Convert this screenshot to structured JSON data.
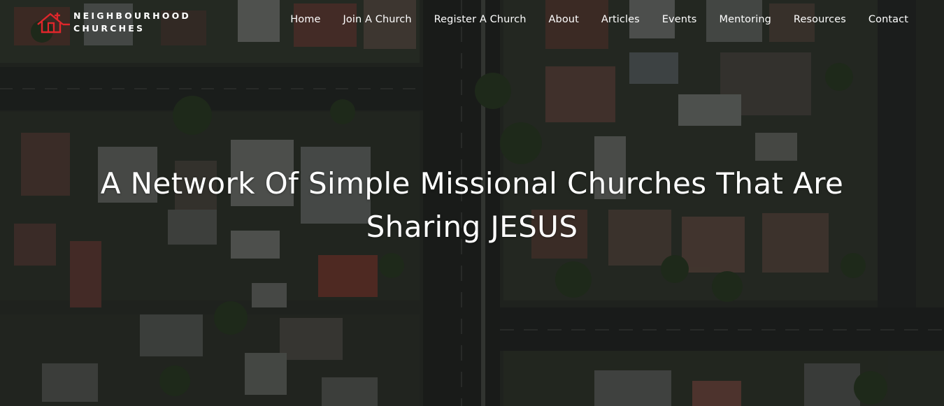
{
  "brand": {
    "line1": "NEIGHBOURHOOD",
    "line2": "CHURCHES",
    "icon": "house-with-cross-icon",
    "accent_color": "#e0262b"
  },
  "nav": {
    "items": [
      {
        "label": "Home"
      },
      {
        "label": "Join A Church"
      },
      {
        "label": "Register A Church"
      },
      {
        "label": "About"
      },
      {
        "label": "Articles"
      },
      {
        "label": "Events"
      },
      {
        "label": "Mentoring"
      },
      {
        "label": "Resources"
      },
      {
        "label": "Contact"
      }
    ]
  },
  "hero": {
    "headline": "A Network Of Simple Missional Churches That Are Sharing JESUS",
    "background": "aerial-suburb-photo"
  }
}
